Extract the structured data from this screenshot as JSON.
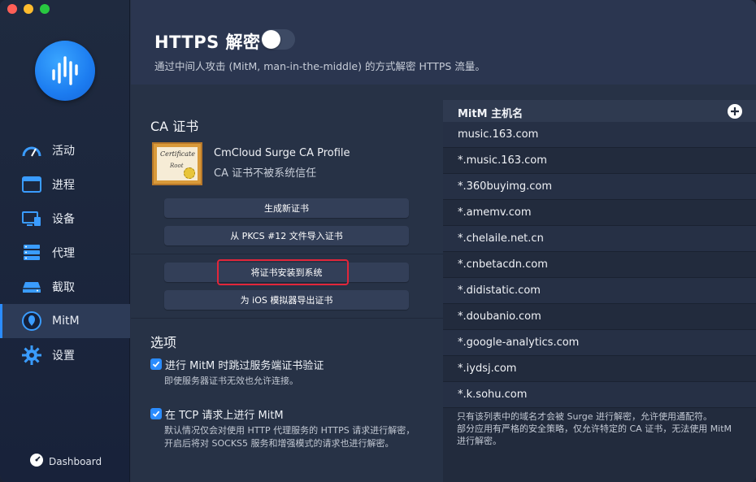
{
  "sidebar": {
    "items": [
      {
        "label": "活动",
        "icon": "gauge-icon"
      },
      {
        "label": "进程",
        "icon": "window-icon"
      },
      {
        "label": "设备",
        "icon": "devices-icon"
      },
      {
        "label": "代理",
        "icon": "server-icon"
      },
      {
        "label": "截取",
        "icon": "drive-icon"
      },
      {
        "label": "MitM",
        "icon": "shield-icon"
      },
      {
        "label": "设置",
        "icon": "gear-icon"
      }
    ],
    "active": "MitM",
    "dashboard_label": "Dashboard"
  },
  "header": {
    "title": "HTTPS 解密",
    "toggle_on": false,
    "subtitle": "通过中间人攻击 (MitM, man-in-the-middle) 的方式解密 HTTPS 流量。"
  },
  "ca": {
    "section_title": "CA 证书",
    "cert_image_title": "Certificate",
    "cert_image_sub": "Root",
    "cert_name": "CmCloud Surge CA Profile",
    "cert_status": "CA 证书不被系统信任",
    "buttons": {
      "generate": "生成新证书",
      "import_pkcs": "从 PKCS #12 文件导入证书",
      "install": "将证书安装到系统",
      "export_ios": "为 iOS 模拟器导出证书"
    }
  },
  "options": {
    "section_title": "选项",
    "skip_verify": {
      "checked": true,
      "label": "进行 MitM 时跳过服务端证书验证",
      "desc": "即使服务器证书无效也允许连接。"
    },
    "tcp_mitm": {
      "checked": true,
      "label": "在 TCP 请求上进行 MitM",
      "desc_line1": "默认情况仅会对使用 HTTP 代理服务的 HTTPS 请求进行解密，",
      "desc_line2": "开启后将对 SOCKS5 服务和增强模式的请求也进行解密。"
    }
  },
  "hosts": {
    "header": "MitM 主机名",
    "items": [
      "music.163.com",
      "*.music.163.com",
      "*.360buyimg.com",
      "*.amemv.com",
      "*.chelaile.net.cn",
      "*.cnbetacdn.com",
      "*.didistatic.com",
      "*.doubanio.com",
      "*.google-analytics.com",
      "*.iydsj.com",
      "*.k.sohu.com"
    ],
    "note_line1": "只有该列表中的域名才会被 Surge 进行解密，允许使用通配符。",
    "note_line2": "部分应用有严格的安全策略，仅允许特定的 CA 证书，无法使用 MitM",
    "note_line3": "进行解密。"
  }
}
